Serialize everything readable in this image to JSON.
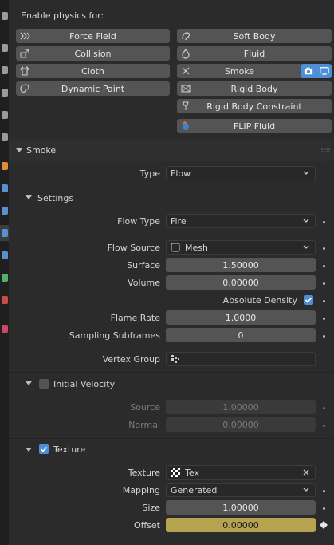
{
  "header": {
    "enable_label": "Enable physics for:"
  },
  "physics_buttons": {
    "force_field": "Force Field",
    "soft_body": "Soft Body",
    "collision": "Collision",
    "fluid": "Fluid",
    "cloth": "Cloth",
    "smoke": "Smoke",
    "dynamic_paint": "Dynamic Paint",
    "rigid_body": "Rigid Body",
    "rigid_body_constraint": "Rigid Body Constraint",
    "flip_fluid": "FLIP Fluid"
  },
  "smoke_panel": {
    "title": "Smoke",
    "type_label": "Type",
    "type_value": "Flow"
  },
  "settings": {
    "title": "Settings",
    "flow_type_label": "Flow Type",
    "flow_type_value": "Fire",
    "flow_source_label": "Flow Source",
    "flow_source_value": "Mesh",
    "surface_label": "Surface",
    "surface_value": "1.50000",
    "volume_label": "Volume",
    "volume_value": "0.00000",
    "absolute_density_label": "Absolute Density",
    "flame_rate_label": "Flame Rate",
    "flame_rate_value": "1.0000",
    "sampling_label": "Sampling Subframes",
    "sampling_value": "0",
    "vertex_group_label": "Vertex Group",
    "vertex_group_value": ""
  },
  "initial_velocity": {
    "title": "Initial Velocity",
    "source_label": "Source",
    "source_value": "1.00000",
    "normal_label": "Normal",
    "normal_value": "0.00000"
  },
  "texture": {
    "title": "Texture",
    "texture_label": "Texture",
    "texture_value": "Tex",
    "mapping_label": "Mapping",
    "mapping_value": "Generated",
    "size_label": "Size",
    "size_value": "1.00000",
    "offset_label": "Offset",
    "offset_value": "0.00000"
  },
  "colors": {
    "accent": "#4e8ed7",
    "keyframed": "#b5a34f",
    "button": "#545454",
    "background": "#2b2b2b"
  }
}
